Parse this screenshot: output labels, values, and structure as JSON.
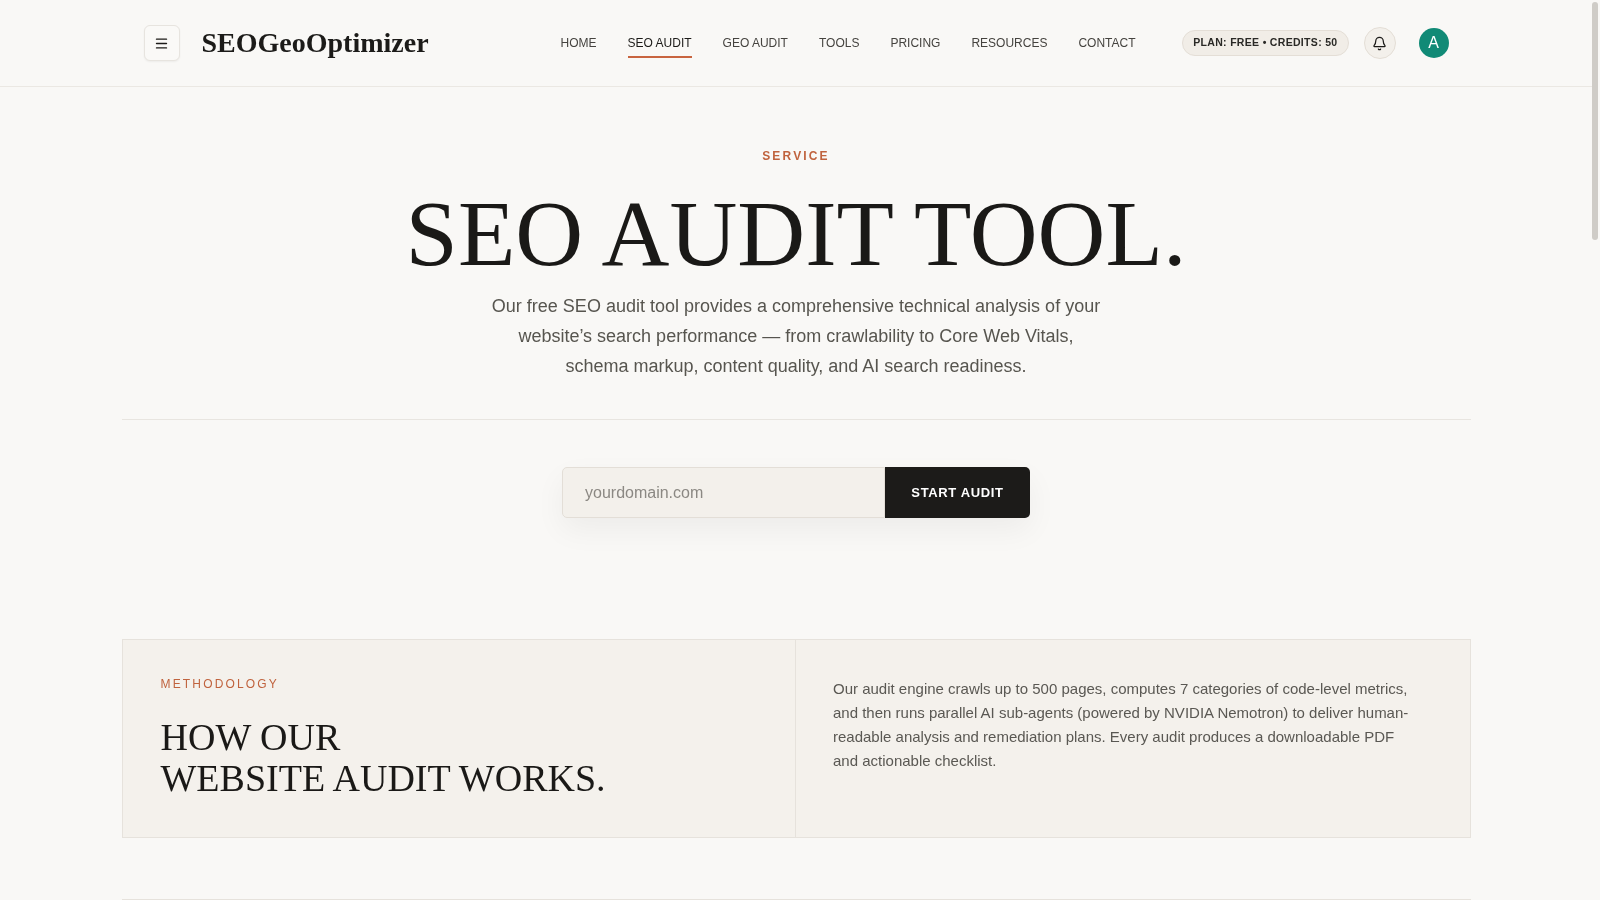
{
  "header": {
    "logo": "SEOGeoOptimizer",
    "nav": [
      {
        "label": "HOME",
        "selected": false
      },
      {
        "label": "SEO AUDIT",
        "selected": true
      },
      {
        "label": "GEO AUDIT",
        "selected": false
      },
      {
        "label": "TOOLS",
        "selected": false
      },
      {
        "label": "PRICING",
        "selected": false
      },
      {
        "label": "RESOURCES",
        "selected": false
      },
      {
        "label": "CONTACT",
        "selected": false
      }
    ],
    "plan_badge": "PLAN: FREE • CREDITS: 50",
    "avatar": "A"
  },
  "hero": {
    "eyebrow": "SERVICE",
    "title": "SEO AUDIT TOOL.",
    "description": "Our free SEO audit tool provides a comprehensive technical analysis of your website’s search performance — from crawlability to Core Web Vitals, schema markup, content quality, and AI search readiness."
  },
  "audit_form": {
    "placeholder": "yourdomain.com",
    "button": "START AUDIT"
  },
  "methodology": {
    "eyebrow": "METHODOLOGY",
    "heading_lines": [
      "HOW OUR",
      "WEBSITE AUDIT WORKS."
    ],
    "body": "Our audit engine crawls up to 500 pages, computes 7 categories of code-level metrics, and then runs parallel AI sub-agents (powered by NVIDIA Nemotron) to deliver human-readable analysis and remediation plans. Every audit produces a downloadable PDF and actionable checklist."
  }
}
